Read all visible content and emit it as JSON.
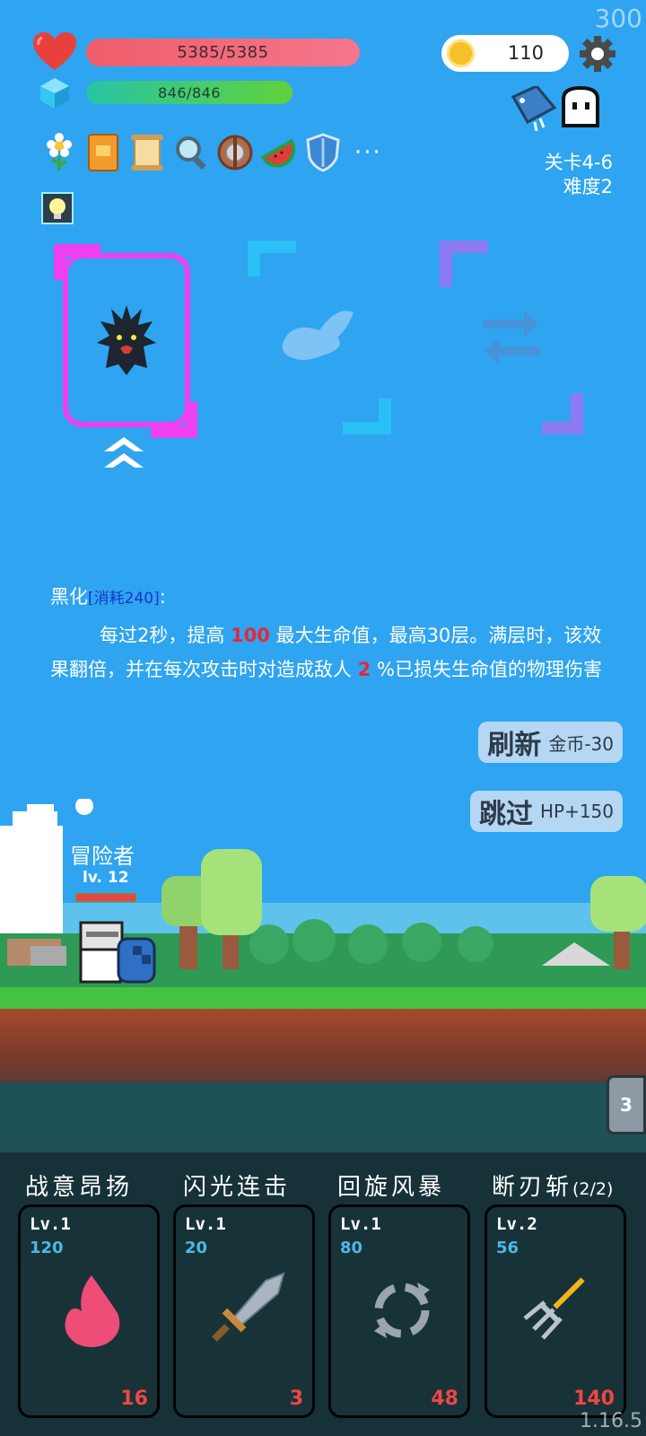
{
  "fps": "300",
  "version": "1.16.5",
  "player": {
    "hp_text": "5385/5385",
    "mp_text": "846/846",
    "coins": "110"
  },
  "stage": {
    "level": "关卡4-6",
    "difficulty": "难度2"
  },
  "relics": [
    "flower",
    "book",
    "scroll",
    "magnifier",
    "shield-wood",
    "watermelon",
    "shield-blue"
  ],
  "more_label": "···",
  "choice": {
    "title": "黑化",
    "cost": "[消耗240]",
    "colon": ":",
    "desc_1": "每过2秒，提高 ",
    "desc_val_1": "100",
    "desc_2": " 最大生命值，最高30层。满层时，该效果翻倍，并在每次攻击时对造成敌人 ",
    "desc_val_2": "2",
    "desc_3": " %已损失生命值的物理伤害"
  },
  "buttons": {
    "refresh_main": "刷新",
    "refresh_sub": "金币-30",
    "skip_main": "跳过",
    "skip_sub": "HP+150"
  },
  "hero": {
    "name": "冒险者",
    "level": "lv. 12"
  },
  "wave_count": "3",
  "skills": [
    {
      "name": "战意昂扬",
      "extra": "",
      "lv": "Lv.1",
      "cost": "120",
      "value": "16",
      "icon": "flame-icon"
    },
    {
      "name": "闪光连击",
      "extra": "",
      "lv": "Lv.1",
      "cost": "20",
      "value": "3",
      "icon": "sword-icon"
    },
    {
      "name": "回旋风暴",
      "extra": "",
      "lv": "Lv.1",
      "cost": "80",
      "value": "48",
      "icon": "cyclone-icon"
    },
    {
      "name": "断刃斩",
      "extra": "(2/2)",
      "lv": "Lv.2",
      "cost": "56",
      "value": "140",
      "icon": "trident-icon"
    }
  ]
}
